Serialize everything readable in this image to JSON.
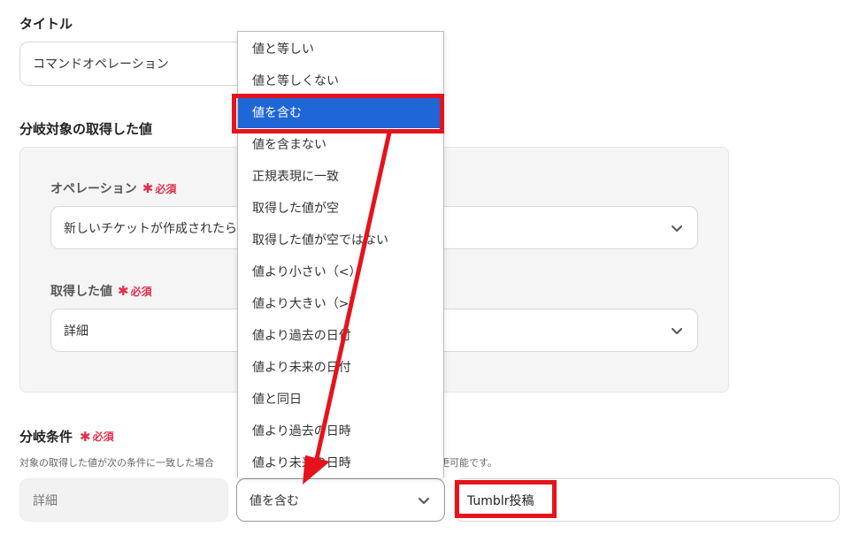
{
  "title_section": {
    "label": "タイトル",
    "value": "コマンドオペレーション"
  },
  "branch_target": {
    "label": "分岐対象の取得した値",
    "operation": {
      "label": "オペレーション",
      "required": "必須",
      "value": "新しいチケットが作成されたら"
    },
    "acquired_value": {
      "label": "取得した値",
      "required": "必須",
      "value": "詳細"
    }
  },
  "branch_condition": {
    "label": "分岐条件",
    "required": "必須",
    "hint_left": "対象の取得した値が次の条件に一致した場合",
    "hint_right": "更可能です。",
    "field": "詳細",
    "operator": "値を含む",
    "value": "Tumblr投稿"
  },
  "dropdown": {
    "selected": "値を含む",
    "options": [
      "値と等しい",
      "値と等しくない",
      "値を含む",
      "値を含まない",
      "正規表現に一致",
      "取得した値が空",
      "取得した値が空ではない",
      "値より小さい（<）",
      "値より大きい（>）",
      "値より過去の日付",
      "値より未来の日付",
      "値と同日",
      "値より過去の日時",
      "値より未来の日時"
    ]
  },
  "colors": {
    "annotation": "#e5141c",
    "selected_bg": "#1f66d6",
    "required": "#e0304a"
  },
  "icons": [
    "chevron-down-icon",
    "annotation-arrow",
    "required-asterisk-icon"
  ]
}
